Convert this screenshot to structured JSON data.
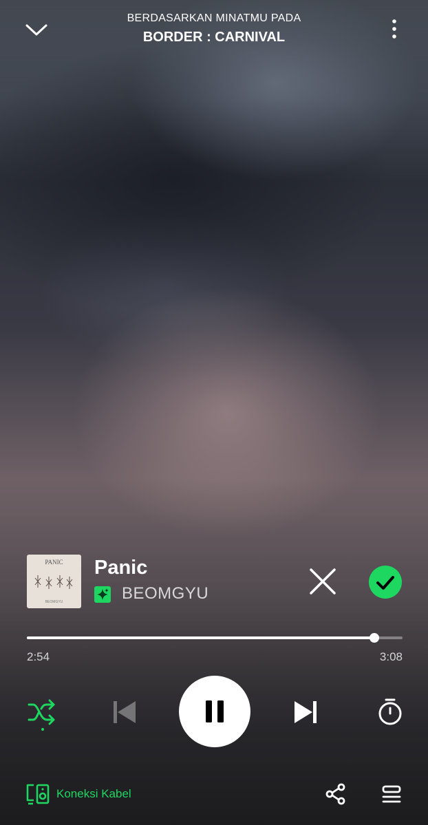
{
  "header": {
    "context_label": "BERDASARKAN MINATMU PADA",
    "context_title": "BORDER : CARNIVAL",
    "collapse_icon": "chevron-down-icon",
    "menu_icon": "more-vertical-icon"
  },
  "track": {
    "title": "Panic",
    "artist": "BEOMGYU",
    "cover_text": "PANIC",
    "cover_footer": "BEOMGYU",
    "remove_icon": "close-icon",
    "saved_icon": "check-circle-icon"
  },
  "progress": {
    "elapsed": "2:54",
    "total": "3:08",
    "fraction": 0.925
  },
  "controls": {
    "shuffle_icon": "shuffle-icon",
    "prev_icon": "skip-previous-icon",
    "play_icon": "pause-icon",
    "next_icon": "skip-next-icon",
    "timer_icon": "sleep-timer-icon"
  },
  "footer": {
    "connection_label": "Koneksi Kabel",
    "connection_icon": "speaker-device-icon",
    "share_icon": "share-icon",
    "queue_icon": "queue-icon"
  },
  "colors": {
    "accent": "#1ed760",
    "text": "#ffffff"
  }
}
